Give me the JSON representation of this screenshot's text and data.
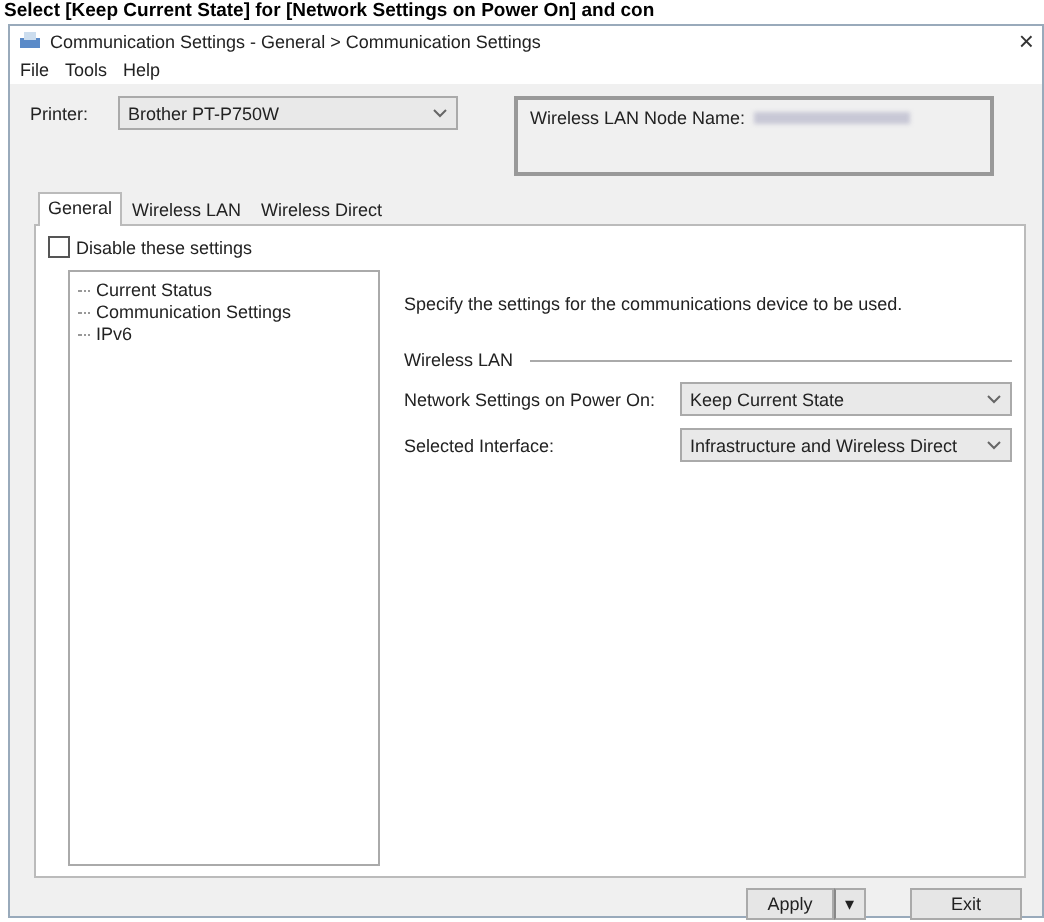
{
  "caption": "Select [Keep Current State] for [Network Settings on Power On] and con",
  "window": {
    "title": "Communication Settings - General > Communication Settings",
    "close": "×"
  },
  "menu": [
    "File",
    "Tools",
    "Help"
  ],
  "printer": {
    "label": "Printer:",
    "value": "Brother PT-P750W"
  },
  "node_name": {
    "label": "Wireless LAN Node Name:"
  },
  "tabs": [
    {
      "label": "General",
      "selected": true
    },
    {
      "label": "Wireless LAN",
      "selected": false
    },
    {
      "label": "Wireless Direct",
      "selected": false
    }
  ],
  "disable": {
    "label": "Disable these settings",
    "checked": false
  },
  "tree": [
    {
      "label": "Current Status",
      "selected": false
    },
    {
      "label": "Communication Settings",
      "selected": false
    },
    {
      "label": "IPv6",
      "selected": false
    }
  ],
  "description": "Specify the settings for the communications device to be used.",
  "group": "Wireless LAN",
  "settings": [
    {
      "label": "Network Settings on Power On:",
      "value": "Keep Current State"
    },
    {
      "label": "Selected Interface:",
      "value": "Infrastructure and Wireless Direct"
    }
  ],
  "buttons": {
    "apply": "Apply",
    "dropdown": "▾",
    "exit": "Exit"
  }
}
